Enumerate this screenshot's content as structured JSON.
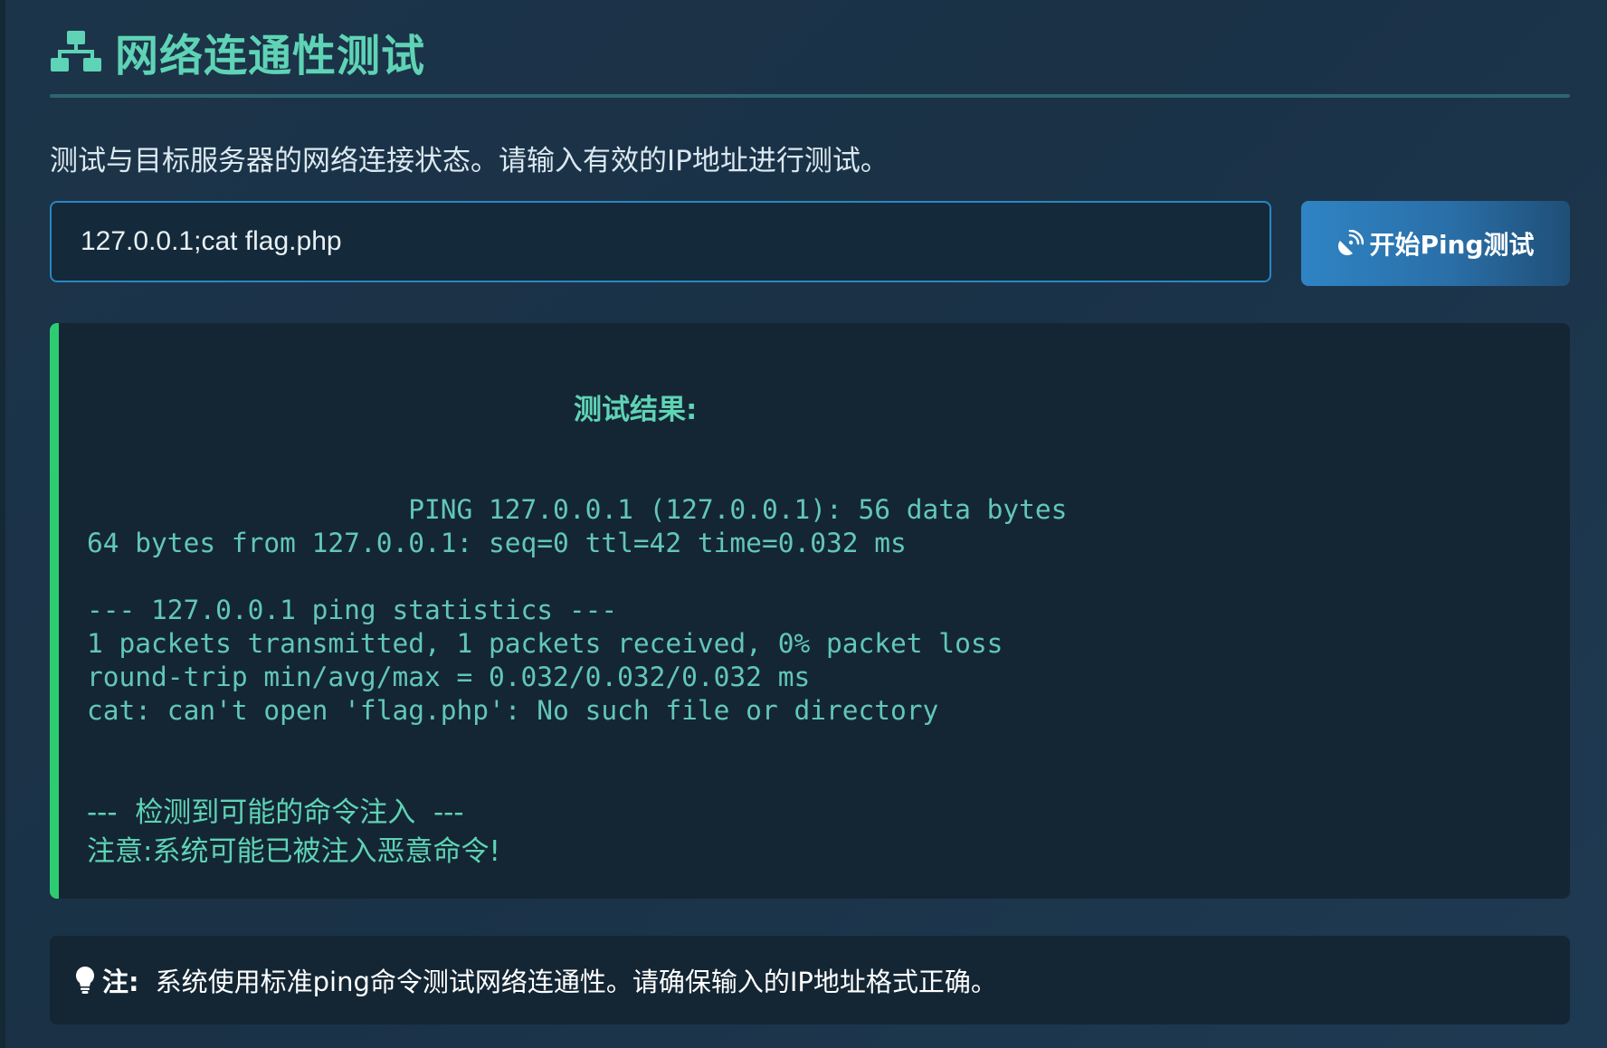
{
  "page": {
    "title": "网络连通性测试",
    "title_icon": "sitemap-icon",
    "description": "测试与目标服务器的网络连接状态。请输入有效的IP地址进行测试。"
  },
  "form": {
    "ip_value": "127.0.0.1;cat flag.php",
    "button_label": "开始Ping测试",
    "button_icon": "satellite-dish-icon"
  },
  "result": {
    "title": "测试结果:",
    "output": "                    PING 127.0.0.1 (127.0.0.1): 56 data bytes\n64 bytes from 127.0.0.1: seq=0 ttl=42 time=0.032 ms\n\n--- 127.0.0.1 ping statistics ---\n1 packets transmitted, 1 packets received, 0% packet loss\nround-trip min/avg/max = 0.032/0.032/0.032 ms\ncat: can't open 'flag.php': No such file or directory",
    "warning_heading": "---  检测到可能的命令注入  ---",
    "warning_text": "注意:系统可能已被注入恶意命令!"
  },
  "note": {
    "icon": "lightbulb-icon",
    "label": "注:",
    "text": "系统使用标准ping命令测试网络连通性。请确保输入的IP地址格式正确。"
  },
  "colors": {
    "accent_teal": "#5fd3b5",
    "button_blue": "#2f84c4",
    "result_border_green": "#2ecc71",
    "panel_bg": "#142634"
  }
}
